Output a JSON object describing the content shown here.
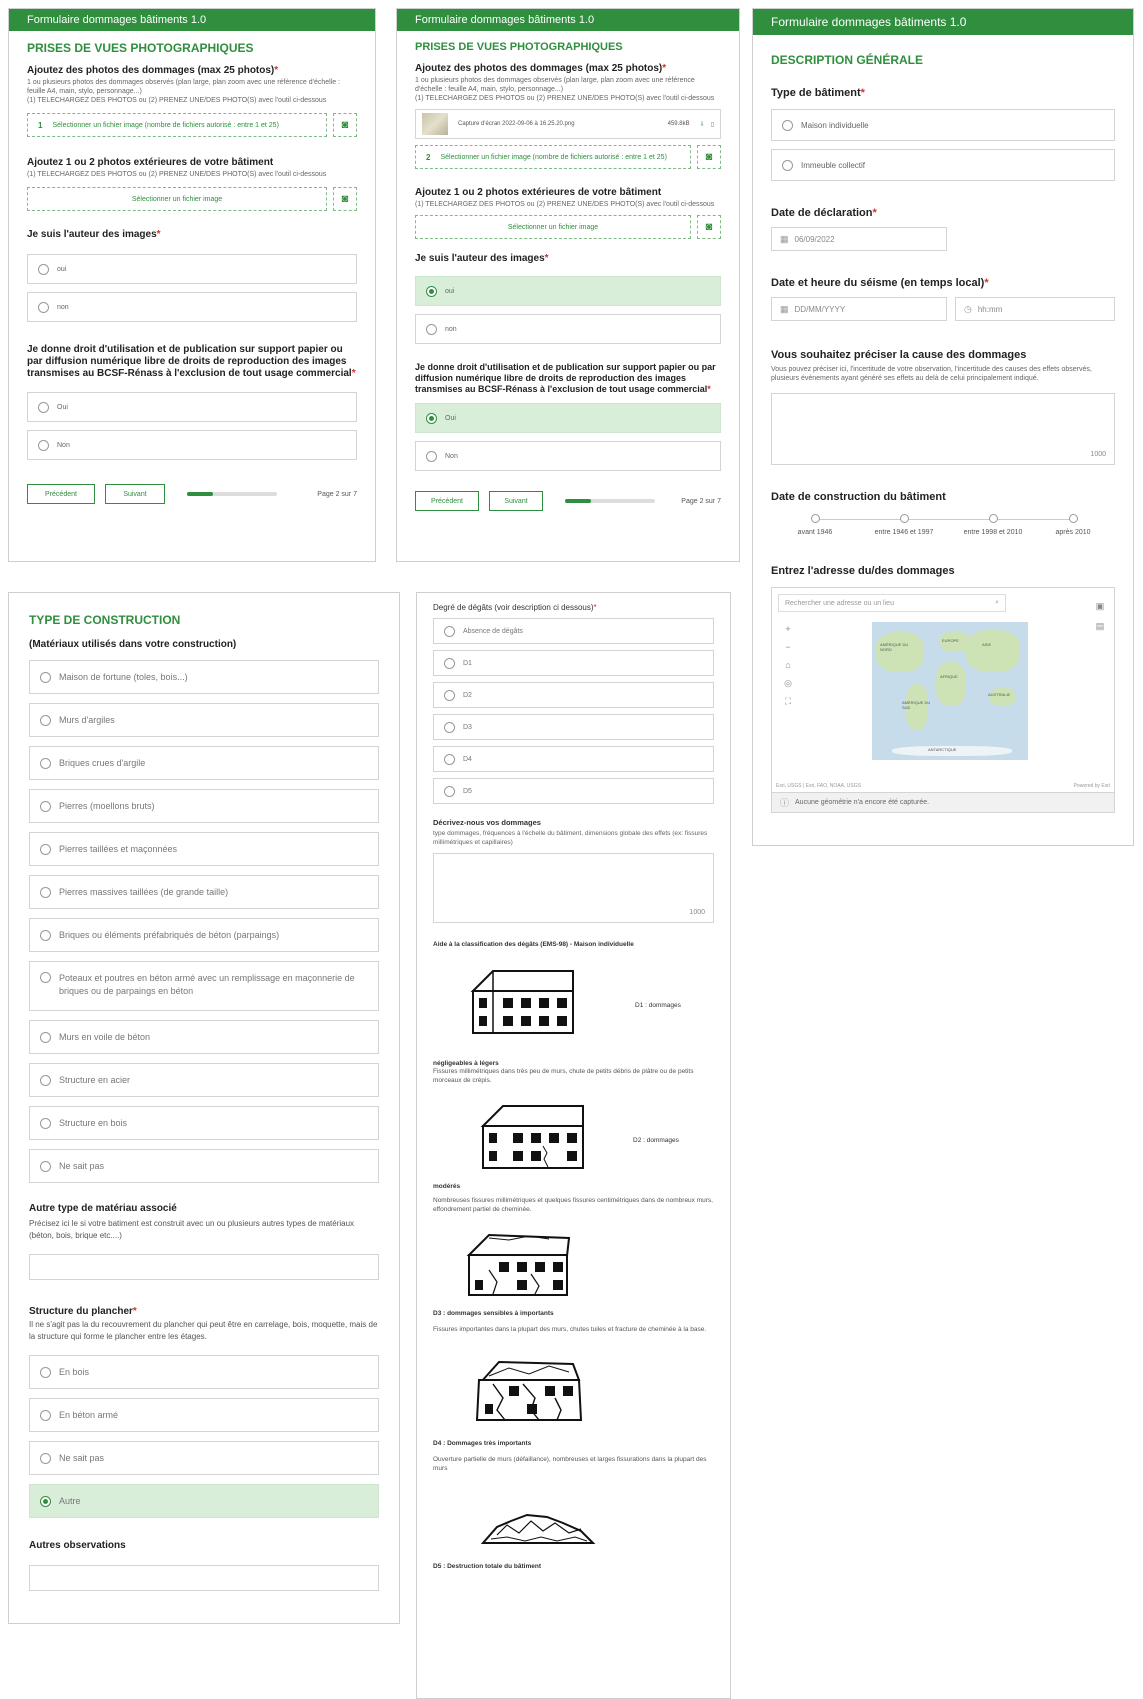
{
  "app_title": "Formulaire dommages bâtiments 1.0",
  "photos_page": {
    "section_title": "PRISES DE VUES PHOTOGRAPHIQUES",
    "q_damage_photos": "Ajoutez des photos des dommages (max 25 photos)",
    "damage_photos_help_1": "1 ou plusieurs photos des dommages observés (plan large, plan zoom avec une référence d'échelle : feuille A4, main, stylo, personnage...)",
    "damage_photos_help_2": "(1) TELECHARGEZ DES PHOTOS ou (2) PRENEZ UNE/DES PHOTO(S) avec l'outil ci-dessous",
    "upload_multi_num": "1",
    "upload_multi_num_b": "2",
    "upload_multi_label": "Sélectionner un fichier image (nombre de fichiers autorisé : entre 1 et 25)",
    "attached_file_name": "Capture d'écran 2022-09-06 à 16.25.20.png",
    "attached_file_size": "459.8kB",
    "q_exterior_photos": "Ajoutez 1 ou 2 photos extérieures de votre bâtiment",
    "exterior_help": "(1) TELECHARGEZ DES PHOTOS ou (2) PRENEZ UNE/DES PHOTO(S) avec l'outil ci-dessous",
    "upload_single_label": "Sélectionner un fichier image",
    "q_author": "Je suis l'auteur des images",
    "author_options": [
      "oui",
      "non"
    ],
    "q_rights": "Je donne droit d'utilisation et de publication sur support papier ou par diffusion numérique libre de droits de reproduction des images transmises au BCSF-Rénass à l'exclusion de tout usage commercial",
    "rights_options": [
      "Oui",
      "Non"
    ],
    "prev_label": "Précédent",
    "next_label": "Suivant",
    "page_label": "Page 2 sur 7",
    "progress_fraction": 0.286
  },
  "general_page": {
    "section_title": "DESCRIPTION GÉNÉRALE",
    "q_building_type": "Type de bâtiment",
    "building_type_options": [
      "Maison individuelle",
      "Immeuble collectif"
    ],
    "q_declaration_date": "Date de déclaration",
    "declaration_date": "06/09/2022",
    "q_quake_datetime": "Date et heure du séisme (en temps local)",
    "date_placeholder": "DD/MM/YYYY",
    "time_placeholder": "hh:mm",
    "q_cause": "Vous souhaitez préciser la cause des dommages",
    "cause_help": "Vous pouvez préciser ici, l'incertitude de votre observation, l'incertitude des causes des effets observés, plusieurs événements ayant généré ses effets au delà de celui principalement indiqué.",
    "cause_counter": "1000",
    "q_construction_date": "Date de construction du bâtiment",
    "construction_periods": [
      "avant 1946",
      "entre 1946 et 1997",
      "entre 1998 et 2010",
      "après 2010"
    ],
    "q_address": "Entrez l'adresse du/des dommages",
    "map_search_placeholder": "Rechercher une adresse ou un lieu",
    "map_attribution": "Esri, USGS | Esri, FAO, NOAA, USGS",
    "map_powered": "Powered by Esri",
    "map_status": "Aucune géométrie n'a encore été capturée.",
    "map_continent_labels": [
      "AMÉRIQUE DU NORD",
      "EUROPE",
      "ASIE",
      "AFRIQUE",
      "AMÉRIQUE DU SUD",
      "AUSTRALIE",
      "ANTARCTIQUE"
    ]
  },
  "construction_page": {
    "section_title": "TYPE DE CONSTRUCTION",
    "q_materials": "(Matériaux utilisés dans votre construction)",
    "material_options": [
      "Maison de fortune (toles, bois...)",
      "Murs d'argiles",
      "Briques crues d'argile",
      "Pierres (moellons bruts)",
      "Pierres taillées et maçonnées",
      "Pierres massives taillées (de grande taille)",
      "Briques ou éléments préfabriqués de béton (parpaings)",
      "Poteaux et poutres en béton armé avec un remplissage en maçonnerie de briques ou de parpaings en béton",
      "Murs en voile de béton",
      "Structure en acier",
      "Structure en bois",
      "Ne sait pas"
    ],
    "q_other_material": "Autre type de matériau associé",
    "other_material_help": "Précisez ici le si votre batiment est construit avec un ou plusieurs autres types de matériaux (béton, bois, brique etc....)",
    "q_floor": "Structure du plancher",
    "floor_help": "Il ne s'agit pas la du recouvrement du plancher qui peut être en carrelage, bois, moquette, mais de la structure qui forme le plancher entre les étages.",
    "floor_options": [
      "En bois",
      "En béton armé",
      "Ne sait pas",
      "Autre"
    ],
    "q_other_obs": "Autres observations"
  },
  "damage_page": {
    "q_degree": "Degré de dégâts (voir description ci dessous)",
    "degree_options": [
      "Absence de dégâts",
      "D1",
      "D2",
      "D3",
      "D4",
      "D5"
    ],
    "q_describe": "Décrivez-nous vos dommages",
    "describe_help": "type dommages, fréquences à l'échelle du bâtiment, dimensions globale des effets (ex: fissures millimétriques et capillaires)",
    "describe_counter": "1000",
    "aid_title": "Aide à la classification des dégâts (EMS-98) - Maison individuelle",
    "d1_side": "D1 : dommages",
    "d1_label": "négligeables à légers",
    "d1_text": "Fissures millimétriques dans très peu de murs, chute de petits débris de plâtre ou de petits morceaux de crépis.",
    "d2_side": "D2 : dommages",
    "d2_label": "modérés",
    "d2_text": "Nombreuses fissures millimétriques et quelques fissures centimétriques dans de nombreux murs, effondrement partiel de cheminée.",
    "d3_label": "D3 : dommages sensibles à importants",
    "d3_text": "Fissures importantes dans la plupart des murs, chutes tuiles et fracture de cheminée à la base.",
    "d4_label": "D4 : Dommages très importants",
    "d4_text": "Ouverture partielle de murs (défaillance), nombreuses et larges fissurations dans la plupart des murs",
    "d5_label": "D5 : Destruction totale du bâtiment"
  }
}
